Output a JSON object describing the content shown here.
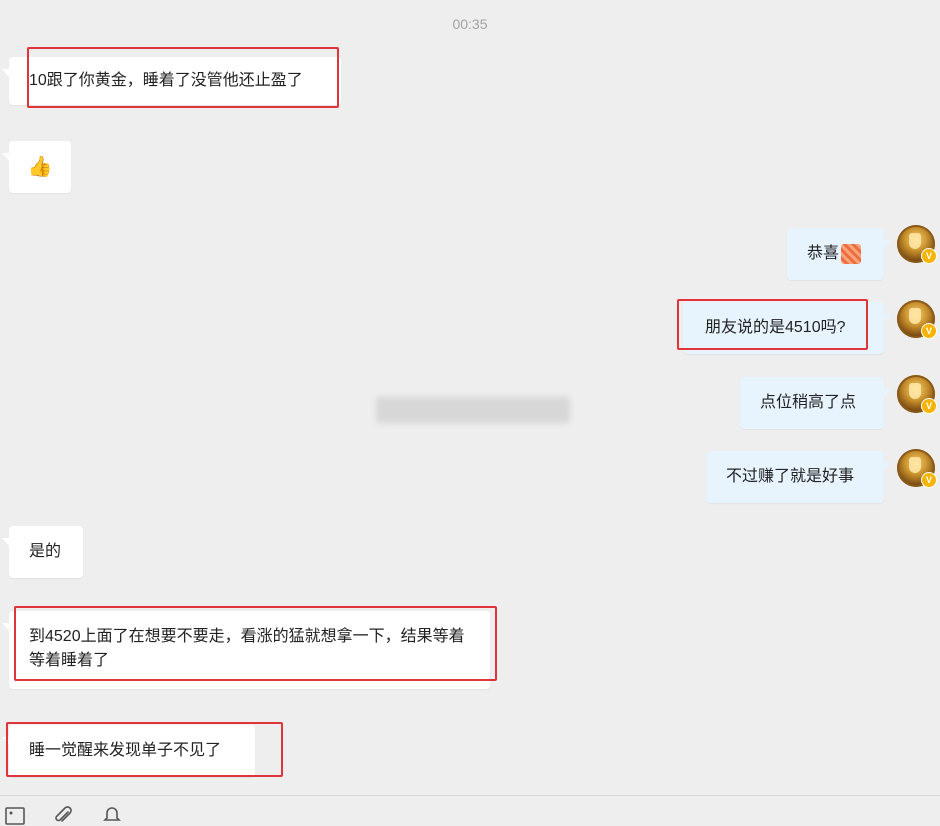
{
  "chat": {
    "timestamp": "00:35",
    "messages": [
      {
        "side": "in",
        "text": "10跟了你黄金，睡着了没管他还止盈了",
        "highlighted": true
      },
      {
        "side": "in",
        "icon": "thumbs-up-emoji"
      },
      {
        "side": "out",
        "text": "恭喜",
        "icon": "zan-sticker-icon"
      },
      {
        "side": "out",
        "text": "朋友说的是4510吗?",
        "highlighted": true
      },
      {
        "side": "out",
        "text": "点位稍高了点"
      },
      {
        "side": "out",
        "text": "不过赚了就是好事"
      },
      {
        "side": "in",
        "text": "是的"
      },
      {
        "side": "in",
        "text": "到4520上面了在想要不要走，看涨的猛就想拿一下，结果等着等着睡着了",
        "highlighted": true
      },
      {
        "side": "in",
        "text": "睡一觉醒来发现单子不见了",
        "highlighted": true
      }
    ]
  },
  "avatar": {
    "badge": "V",
    "icon": "trophy-avatar-icon"
  },
  "toolbar": {
    "icons": [
      "image-icon",
      "paperclip-icon",
      "bell-icon"
    ]
  },
  "colors": {
    "incoming_bubble": "#ffffff",
    "outgoing_bubble": "#e7f3fd",
    "highlight_box": "#e0343a",
    "background": "#eeeeee",
    "verified_badge": "#f6b400"
  }
}
